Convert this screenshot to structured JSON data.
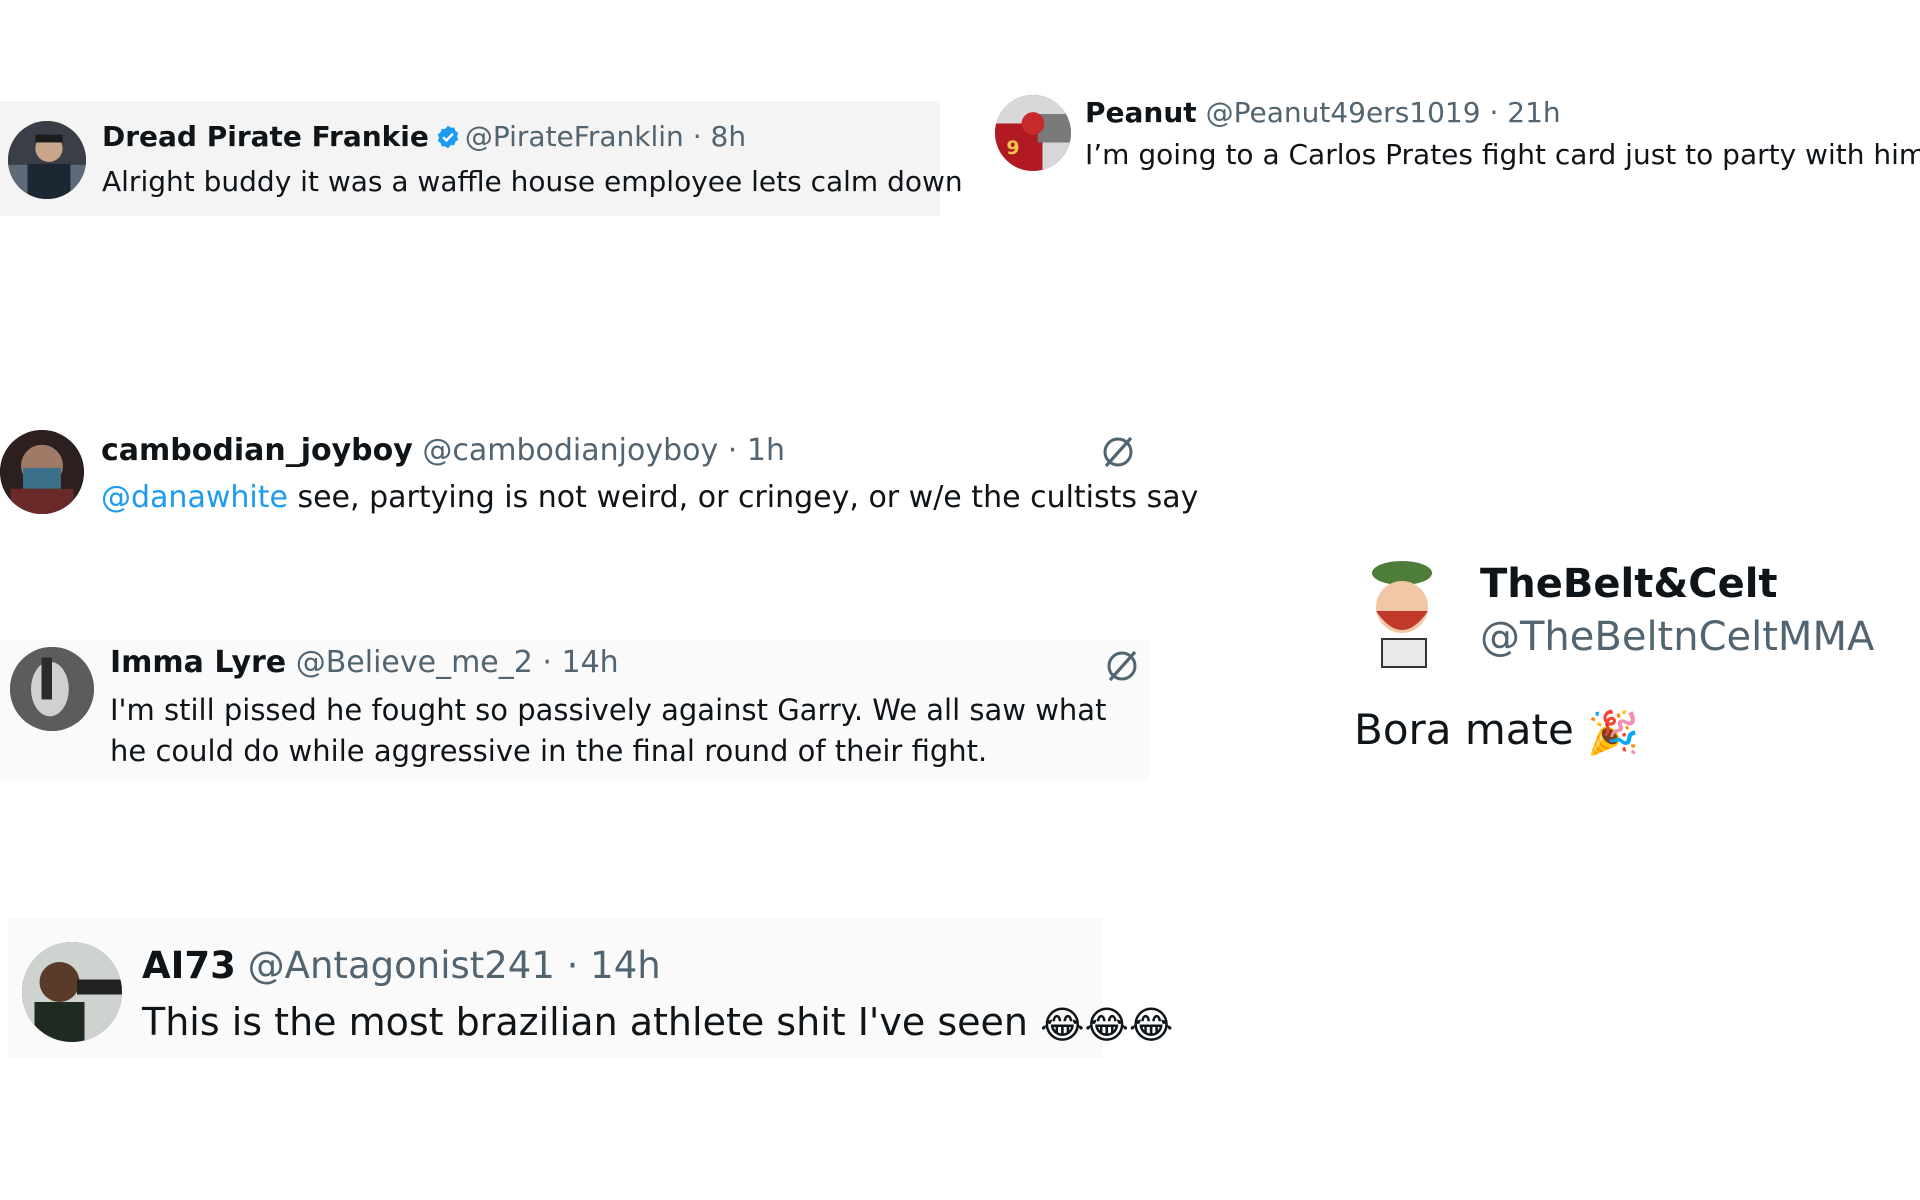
{
  "tweets": [
    {
      "name": "Dread Pirate Frankie",
      "handle": "@PirateFranklin",
      "separator": "·",
      "time": "8h",
      "verified": true,
      "text": "Alright buddy it was a waffle house employee lets calm down"
    },
    {
      "name": "Peanut",
      "handle": "@Peanut49ers1019",
      "separator": "·",
      "time": "21h",
      "text": "I’m going to a Carlos Prates fight card just to party with him after"
    },
    {
      "name": "cambodian_joyboy",
      "handle": "@cambodianjoyboy",
      "separator": "·",
      "time": "1h",
      "mention": "@danawhite",
      "text": " see, partying is not weird, or cringey, or w/e the cultists say",
      "icon": "grok-icon"
    },
    {
      "name": "Imma Lyre",
      "handle": "@Believe_me_2",
      "separator": "·",
      "time": "14h",
      "text": "I'm still pissed he fought so passively against Garry. We all saw what he could do while aggressive in the final round of their fight.",
      "icon": "grok-icon"
    },
    {
      "name": "AI73",
      "handle": "@Antagonist241",
      "separator": "·",
      "time": "14h",
      "text": "This is the most brazilian athlete shit I've seen",
      "emoji": "😂😂😂"
    },
    {
      "name": "TheBelt&Celt",
      "handle": "@TheBeltnCeltMMA",
      "text": "Bora mate",
      "emoji": "🎉"
    }
  ],
  "colors": {
    "mention": "#1d9bf0",
    "verified": "#1d9bf0",
    "secondary_text": "#536471"
  }
}
